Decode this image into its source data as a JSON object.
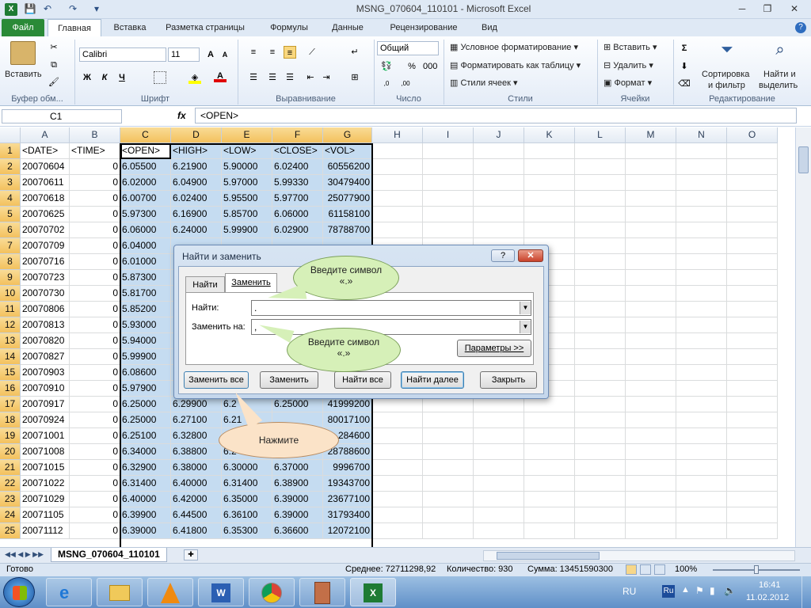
{
  "window": {
    "title": "MSNG_070604_110101 - Microsoft Excel"
  },
  "tabs": [
    "Файл",
    "Главная",
    "Вставка",
    "Разметка страницы",
    "Формулы",
    "Данные",
    "Рецензирование",
    "Вид"
  ],
  "ribbon": {
    "clipboard": {
      "paste": "Вставить",
      "group": "Буфер обм..."
    },
    "font": {
      "name": "Calibri",
      "size": "11",
      "bold": "Ж",
      "italic": "К",
      "underline": "Ч",
      "group": "Шрифт"
    },
    "alignment": {
      "group": "Выравнивание"
    },
    "number": {
      "format": "Общий",
      "percent": "%",
      "group": "Число"
    },
    "styles": {
      "cond": "Условное форматирование",
      "table": "Форматировать как таблицу",
      "cell": "Стили ячеек",
      "group": "Стили"
    },
    "cells": {
      "insert": "Вставить",
      "delete": "Удалить",
      "format": "Формат",
      "group": "Ячейки"
    },
    "editing": {
      "sort": "Сортировка",
      "sort2": "и фильтр",
      "find": "Найти и",
      "find2": "выделить",
      "group": "Редактирование"
    }
  },
  "formula": {
    "namebox": "C1",
    "fx": "fx",
    "value": "<OPEN>"
  },
  "columns": [
    "A",
    "B",
    "C",
    "D",
    "E",
    "F",
    "G",
    "H",
    "I",
    "J",
    "K",
    "L",
    "M",
    "N",
    "O"
  ],
  "rows": [
    [
      "<DATE>",
      "<TIME>",
      "<OPEN>",
      "<HIGH>",
      "<LOW>",
      "<CLOSE>",
      "<VOL>"
    ],
    [
      "20070604",
      "0",
      "6.05500",
      "6.21900",
      "5.90000",
      "6.02400",
      "60556200"
    ],
    [
      "20070611",
      "0",
      "6.02000",
      "6.04900",
      "5.97000",
      "5.99330",
      "30479400"
    ],
    [
      "20070618",
      "0",
      "6.00700",
      "6.02400",
      "5.95500",
      "5.97700",
      "25077900"
    ],
    [
      "20070625",
      "0",
      "5.97300",
      "6.16900",
      "5.85700",
      "6.06000",
      "61158100"
    ],
    [
      "20070702",
      "0",
      "6.06000",
      "6.24000",
      "5.99900",
      "6.02900",
      "78788700"
    ],
    [
      "20070709",
      "0",
      "6.04000",
      "",
      "",
      "",
      ""
    ],
    [
      "20070716",
      "0",
      "6.01000",
      "",
      "",
      "",
      ""
    ],
    [
      "20070723",
      "0",
      "5.87300",
      "",
      "",
      "",
      ""
    ],
    [
      "20070730",
      "0",
      "5.81700",
      "",
      "",
      "",
      ""
    ],
    [
      "20070806",
      "0",
      "5.85200",
      "",
      "",
      "",
      ""
    ],
    [
      "20070813",
      "0",
      "5.93000",
      "",
      "",
      "",
      ""
    ],
    [
      "20070820",
      "0",
      "5.94000",
      "",
      "",
      "",
      ""
    ],
    [
      "20070827",
      "0",
      "5.99900",
      "",
      "",
      "",
      ""
    ],
    [
      "20070903",
      "0",
      "6.08600",
      "",
      "",
      "",
      ""
    ],
    [
      "20070910",
      "0",
      "5.97900",
      "",
      "",
      "",
      ""
    ],
    [
      "20070917",
      "0",
      "6.25000",
      "6.29900",
      "6.2",
      "6.25000",
      "41999200"
    ],
    [
      "20070924",
      "0",
      "6.25000",
      "6.27100",
      "6.21",
      "",
      "80017100"
    ],
    [
      "20071001",
      "0",
      "6.25100",
      "6.32800",
      "",
      "",
      "284600"
    ],
    [
      "20071008",
      "0",
      "6.34000",
      "6.38800",
      "6.2",
      "",
      "28788600"
    ],
    [
      "20071015",
      "0",
      "6.32900",
      "6.38000",
      "6.30000",
      "6.37000",
      "9996700"
    ],
    [
      "20071022",
      "0",
      "6.31400",
      "6.40000",
      "6.31400",
      "6.38900",
      "19343700"
    ],
    [
      "20071029",
      "0",
      "6.40000",
      "6.42000",
      "6.35000",
      "6.39000",
      "23677100"
    ],
    [
      "20071105",
      "0",
      "6.39900",
      "6.44500",
      "6.36100",
      "6.39000",
      "31793400"
    ],
    [
      "20071112",
      "0",
      "6.39000",
      "6.41800",
      "6.35300",
      "6.36600",
      "12072100"
    ]
  ],
  "sheet": {
    "tab": "MSNG_070604_110101"
  },
  "status": {
    "ready": "Готово",
    "avg": "Среднее: 72711298,92",
    "count": "Количество: 930",
    "sum": "Сумма: 13451590300",
    "zoom": "100%"
  },
  "dialog": {
    "title": "Найти и заменить",
    "tab_find": "Найти",
    "tab_replace": "Заменить",
    "find_label": "Найти:",
    "find_value": ".",
    "replace_label": "Заменить на:",
    "replace_value": ",",
    "options": "Параметры >>",
    "btn_replace_all": "Заменить все",
    "btn_replace": "Заменить",
    "btn_find_all": "Найти все",
    "btn_find_next": "Найти далее",
    "btn_close": "Закрыть"
  },
  "callouts": {
    "c1": "Введите символ «.»",
    "c2": "Введите символ «.»",
    "c3": "Нажмите"
  },
  "tray": {
    "lang": "RU",
    "time": "16:41",
    "date": "11.02.2012"
  }
}
